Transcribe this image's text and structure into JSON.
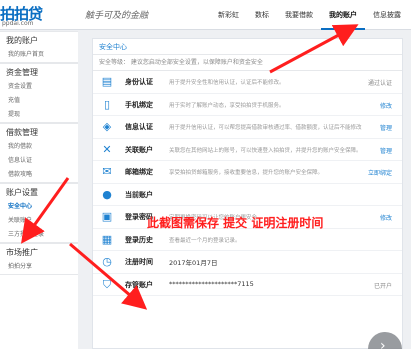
{
  "header": {
    "logo_main": "拍拍贷",
    "logo_sub": "ppdai.com",
    "slogan": "触手可及的金融",
    "nav": [
      {
        "label": "新彩虹",
        "active": false
      },
      {
        "label": "数标",
        "active": false
      },
      {
        "label": "我要借款",
        "active": false
      },
      {
        "label": "我的账户",
        "active": true
      },
      {
        "label": "信息披露",
        "active": false
      }
    ]
  },
  "sidebar": {
    "groups": [
      {
        "title": "我的账户",
        "items": [
          "我的账户首页"
        ]
      },
      {
        "title": "资金管理",
        "items": [
          "资金设置",
          "充值",
          "提现"
        ]
      },
      {
        "title": "借款管理",
        "items": [
          "我的借款",
          "信息认证",
          "借款攻略"
        ]
      },
      {
        "title": "账户设置",
        "items": [
          "安全中心",
          "关联账户",
          "三方授权登录"
        ],
        "active_item": "安全中心"
      },
      {
        "title": "市场推广",
        "items": [
          "拍拍分享"
        ]
      }
    ]
  },
  "main": {
    "title": "安全中心",
    "level_text": "安全等级：  建议您启动全部安全设置，以保障账户和资金安全",
    "rows": [
      {
        "icon": "id-card-icon",
        "glyph": "▤",
        "name": "身份认证",
        "desc": "用于提升安全性和信用认证，认证后不能修改。",
        "action": "通过认证",
        "action_grey": true
      },
      {
        "icon": "phone-icon",
        "glyph": "▯",
        "name": "手机绑定",
        "desc": "用于实时了解账户动态，享受拍拍贷手机服务。",
        "action": "修改",
        "action_grey": false
      },
      {
        "icon": "shield-icon",
        "glyph": "◈",
        "name": "信息认证",
        "desc": "用于提升信用认证，可以帮您提高借款审核通过率、借款额度，认证后不能修改",
        "action": "管理",
        "action_grey": false
      },
      {
        "icon": "link-icon",
        "glyph": "✕",
        "name": "关联账户",
        "desc": "关联您在其他网站上的账号，可以快速登入拍拍贷，并提升您的账户安全保障。",
        "action": "管理",
        "action_grey": false
      },
      {
        "icon": "mail-icon",
        "glyph": "✉",
        "name": "邮箱绑定",
        "desc": "享受拍拍贷邮箱服务，接收重要信息，提升您的账户安全保障。",
        "action": "立即绑定",
        "action_grey": false
      },
      {
        "icon": "user-icon",
        "glyph": "●",
        "name": "当前账户",
        "desc": "",
        "value": "",
        "action": "",
        "action_grey": false
      },
      {
        "icon": "lock-icon",
        "glyph": "▣",
        "name": "登录密码",
        "desc": "定期更换密码可以让您的账户更安全。",
        "action": "修改",
        "action_grey": false
      },
      {
        "icon": "history-icon",
        "glyph": "▦",
        "name": "登录历史",
        "desc": "查看最近一个月的登录记录。",
        "action": "",
        "action_grey": false
      },
      {
        "icon": "clock-icon",
        "glyph": "◷",
        "name": "注册时间",
        "desc": "",
        "value": "2017年01月7日",
        "action": "",
        "action_grey": false
      },
      {
        "icon": "shield-check-icon",
        "glyph": "⛉",
        "name": "存管账户",
        "desc": "",
        "value": "*********************7115",
        "action": "已开户",
        "action_grey": true
      }
    ]
  },
  "annotation": {
    "text": "此截图需保存 提交 证明注册时间",
    "color": "#ff1e1e"
  },
  "colors": {
    "accent": "#1f82d1",
    "annotation": "#ff1e1e"
  }
}
